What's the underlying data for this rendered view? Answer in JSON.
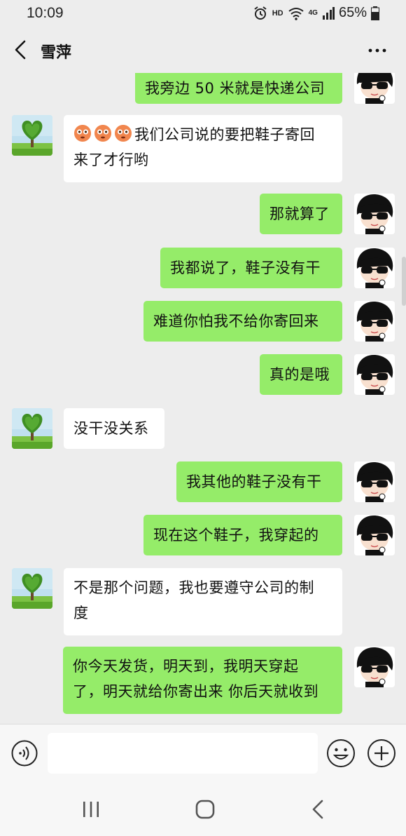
{
  "status": {
    "time": "10:09",
    "hd": "HD",
    "network": "4G",
    "battery": "65%"
  },
  "header": {
    "title": "雪萍"
  },
  "messages": [
    {
      "from": "me",
      "text": "我旁边 50 米就是快递公司"
    },
    {
      "from": "them",
      "text": "我们公司说的要把鞋子寄回来了才行哟",
      "line1": "我们公司说的要把鞋子寄回",
      "line2": "来了才行哟",
      "emoji": [
        "flushed-emoji",
        "flushed-emoji",
        "flushed-emoji"
      ]
    },
    {
      "from": "me",
      "text": "那就算了"
    },
    {
      "from": "me",
      "text": "我都说了，鞋子没有干"
    },
    {
      "from": "me",
      "text": "难道你怕我不给你寄回来"
    },
    {
      "from": "me",
      "text": "真的是哦"
    },
    {
      "from": "them",
      "text": "没干没关系"
    },
    {
      "from": "me",
      "text": "我其他的鞋子没有干"
    },
    {
      "from": "me",
      "text": "现在这个鞋子，我穿起的"
    },
    {
      "from": "them",
      "text": "不是那个问题，我也要遵守公司的制度",
      "line1": "不是那个问题，我也要遵守公司的制",
      "line2": "度"
    },
    {
      "from": "me",
      "text": "你今天发货，明天到，我明天穿起了，明天就给你寄出来 你后天就收到",
      "line1": "你今天发货，明天到，我明天穿起",
      "line2": "了，明天就给你寄出来 你后天就收到"
    }
  ],
  "input": {
    "placeholder": ""
  },
  "icons": {
    "back": "back-arrow-icon",
    "more": "more-icon",
    "voice": "voice-icon",
    "emoji": "emoji-icon",
    "plus": "plus-icon",
    "nav_recent": "recent-apps-icon",
    "nav_home": "home-icon",
    "nav_back": "nav-back-icon"
  },
  "colors": {
    "my_bubble": "#95ec69",
    "their_bubble": "#ffffff",
    "background": "#ededed"
  }
}
